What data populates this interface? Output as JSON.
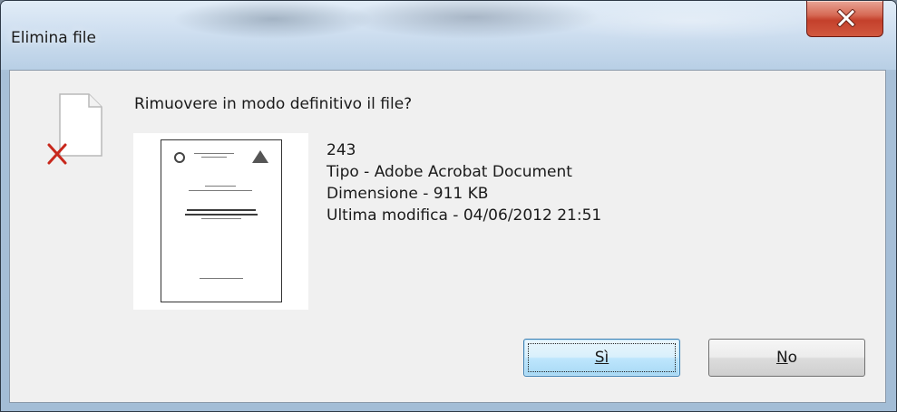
{
  "window": {
    "title": "Elimina file",
    "close_icon": "close-icon"
  },
  "dialog": {
    "question": "Rimuovere in modo definitivo il file?",
    "file_icon": "document-delete-icon",
    "file": {
      "name": "243",
      "type": "Tipo - Adobe Acrobat Document",
      "size": "Dimensione - 911 KB",
      "modified": "Ultima modifica - 04/06/2012 21:51"
    }
  },
  "buttons": {
    "yes_label": "Sì",
    "no_label": "No"
  },
  "colors": {
    "close_button": "#c4402b",
    "focused_button_border": "#3c7fb1",
    "content_background": "#f0f0f0"
  }
}
